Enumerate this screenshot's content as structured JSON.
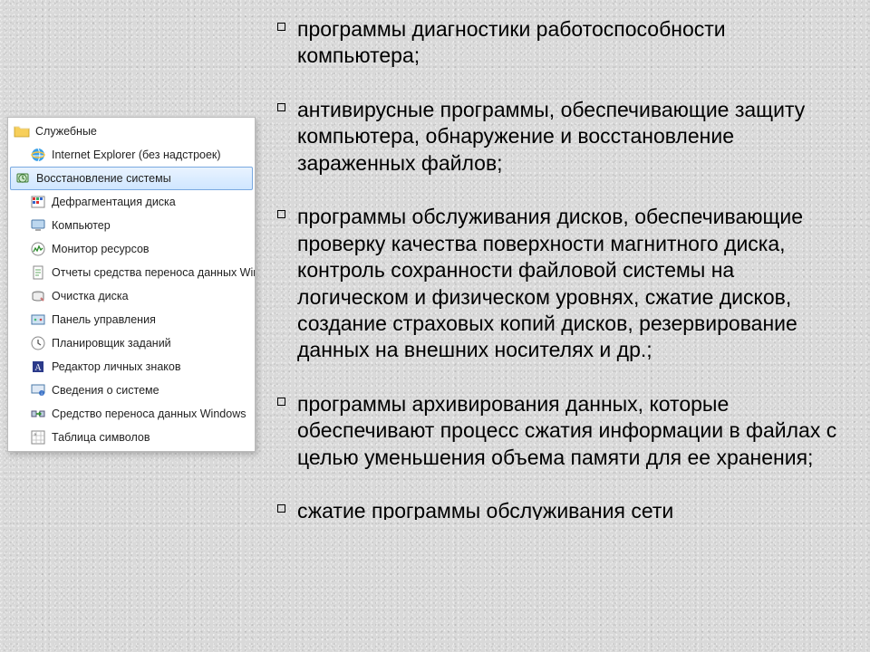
{
  "menu": {
    "folder": "Служебные",
    "items": [
      {
        "label": "Internet Explorer (без надстроек)",
        "icon": "ie"
      },
      {
        "label": "Восстановление системы",
        "icon": "restore",
        "selected": true
      },
      {
        "label": "Дефрагментация диска",
        "icon": "defrag"
      },
      {
        "label": "Компьютер",
        "icon": "computer"
      },
      {
        "label": "Монитор ресурсов",
        "icon": "resmon"
      },
      {
        "label": "Отчеты средства переноса данных Wind",
        "icon": "report"
      },
      {
        "label": "Очистка диска",
        "icon": "cleanup"
      },
      {
        "label": "Панель управления",
        "icon": "cpl"
      },
      {
        "label": "Планировщик заданий",
        "icon": "sched"
      },
      {
        "label": "Редактор личных знаков",
        "icon": "eudc"
      },
      {
        "label": "Сведения о системе",
        "icon": "sysinfo"
      },
      {
        "label": "Средство переноса данных Windows",
        "icon": "migrate"
      },
      {
        "label": "Таблица символов",
        "icon": "charmap"
      }
    ]
  },
  "bullets": [
    " программы диагностики работоспособности компьютера;",
    " антивирусные программы, обеспечивающие защиту компьютера, обнаружение и восстановление зараженных файлов;",
    " программы обслуживания дисков, обеспечивающие проверку качества поверхности магнитного диска, контроль сохранности файловой системы на логическом и физическом уровнях, сжатие дисков, создание страховых копий дисков, резервирование данных на внешних носителях и др.;",
    " программы архивирования данных, которые обеспечивают процесс сжатия информации в файлах с целью уменьшения объема памяти для ее хранения;",
    " сжатие программы обслуживания сети"
  ]
}
